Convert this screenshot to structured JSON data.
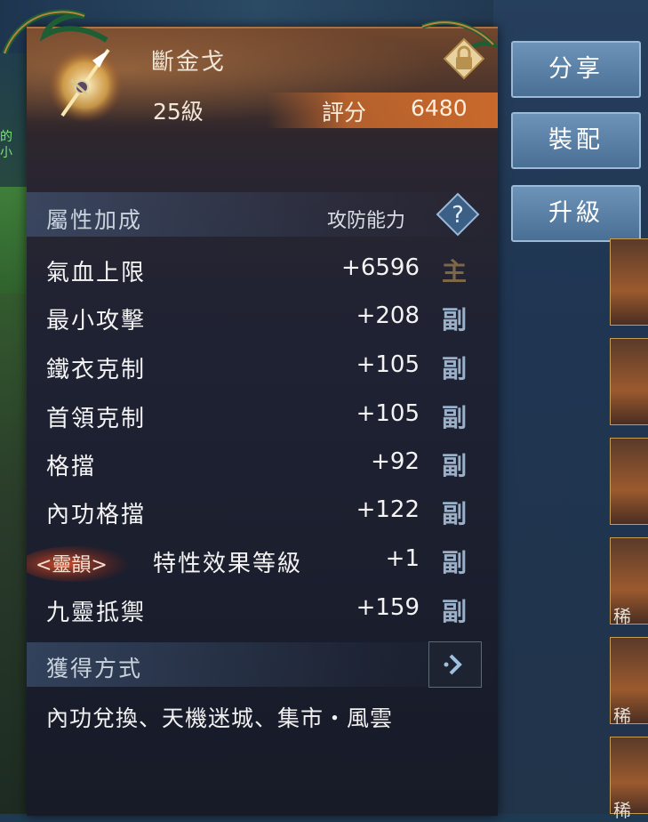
{
  "background": {
    "green_text": "的 小 "
  },
  "item": {
    "name": "斷金戈",
    "level": "25級",
    "score_label": "評分",
    "score_value": "6480"
  },
  "attributes": {
    "title": "屬性加成",
    "power_label": "攻防能力",
    "help_icon": "?",
    "rows": [
      {
        "name": "氣血上限",
        "value": "+6596",
        "tag": "主"
      },
      {
        "name": "最小攻擊",
        "value": "+208",
        "tag": "副"
      },
      {
        "name": "鐵衣克制",
        "value": "+105",
        "tag": "副"
      },
      {
        "name": "首領克制",
        "value": "+105",
        "tag": "副"
      },
      {
        "name": "格擋",
        "value": "+92",
        "tag": "副"
      },
      {
        "name": "內功格擋",
        "value": "+122",
        "tag": "副"
      },
      {
        "name": "特性效果等級",
        "value": "+1",
        "tag": "副",
        "rune": "<靈韻>"
      },
      {
        "name": "九靈抵禦",
        "value": "+159",
        "tag": "副"
      }
    ]
  },
  "source": {
    "title": "獲得方式",
    "text": "內功兌換、天機迷城、集市・風雲"
  },
  "side_buttons": {
    "share": "分享",
    "equip": "裝配",
    "upgrade": "升級"
  },
  "thumbnails": {
    "rare_label": "稀"
  },
  "colors": {
    "accent": "#c9692c",
    "button": "#5a80a6",
    "tag_sub": "#9ab0c8",
    "tag_main": "#7c6848"
  },
  "icons": {
    "item": "spear-weapon-icon",
    "lock": "lock-icon",
    "help": "question-icon",
    "arrow": "chevron-right-icon"
  }
}
